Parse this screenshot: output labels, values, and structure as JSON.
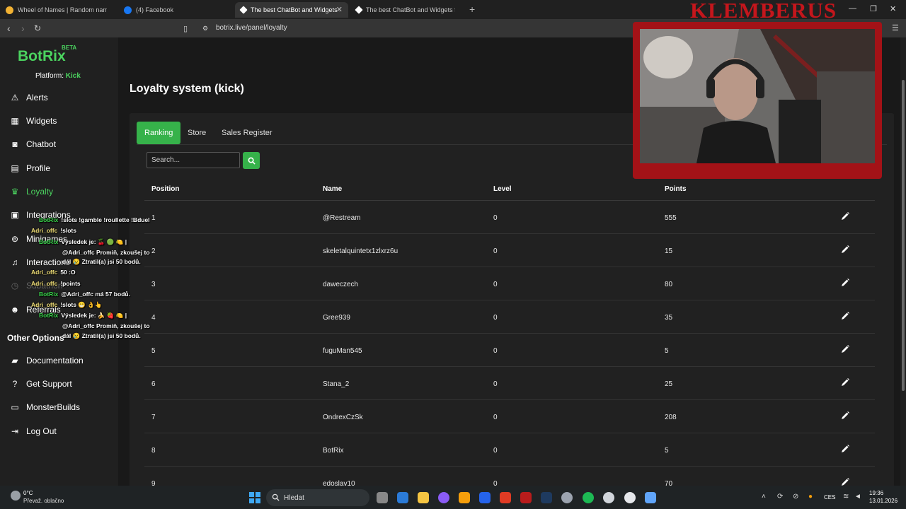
{
  "browser": {
    "tabs": [
      {
        "title": "Wheel of Names | Random name picker",
        "favicon_color": "#f2b233",
        "active": false
      },
      {
        "title": "(4) Facebook",
        "favicon_color": "#1877f2",
        "active": false
      },
      {
        "title": "The best ChatBot and Widgets for Kick",
        "favicon_color": "#ffffff",
        "active": true
      },
      {
        "title": "The best ChatBot and Widgets for Kick",
        "favicon_color": "#ffffff",
        "active": false
      }
    ],
    "url": "botrix.live/panel/loyalty"
  },
  "sidebar": {
    "logo": "BotRix",
    "beta": "BETA",
    "platform_label": "Platform:",
    "platform_value": "Kick",
    "items": [
      {
        "label": "Alerts",
        "icon": "warning-icon"
      },
      {
        "label": "Widgets",
        "icon": "grid-icon"
      },
      {
        "label": "Chatbot",
        "icon": "robot-icon"
      },
      {
        "label": "Profile",
        "icon": "id-card-icon"
      },
      {
        "label": "Loyalty",
        "icon": "trophy-icon",
        "active": true
      },
      {
        "label": "Integrations",
        "icon": "plug-icon"
      },
      {
        "label": "Minigames",
        "icon": "gamepad-icon"
      },
      {
        "label": "Interactions",
        "icon": "music-icon"
      },
      {
        "label": "Subathon",
        "icon": "clock-icon"
      },
      {
        "label": "Referrals",
        "icon": "users-icon"
      }
    ],
    "other_options": "Other Options",
    "other_items": [
      {
        "label": "Documentation",
        "icon": "book-icon"
      },
      {
        "label": "Get Support",
        "icon": "question-icon"
      },
      {
        "label": "MonsterBuilds",
        "icon": "monitor-icon"
      },
      {
        "label": "Log Out",
        "icon": "logout-icon"
      }
    ]
  },
  "main": {
    "title": "Loyalty system (kick)",
    "tabs": [
      {
        "label": "Ranking",
        "active": true
      },
      {
        "label": "Store"
      },
      {
        "label": "Sales Register"
      }
    ],
    "search_placeholder": "Search...",
    "columns": [
      "Position",
      "Name",
      "Level",
      "Points"
    ],
    "rows": [
      {
        "position": "1",
        "name": "@Restream",
        "level": "0",
        "points": "555"
      },
      {
        "position": "2",
        "name": "skeletalquintetx1zlxrz6u",
        "level": "0",
        "points": "15"
      },
      {
        "position": "3",
        "name": "daweczech",
        "level": "0",
        "points": "80"
      },
      {
        "position": "4",
        "name": "Gree939",
        "level": "0",
        "points": "35"
      },
      {
        "position": "5",
        "name": "fuguMan545",
        "level": "0",
        "points": "5"
      },
      {
        "position": "6",
        "name": "Stana_2",
        "level": "0",
        "points": "25"
      },
      {
        "position": "7",
        "name": "OndrexCzSk",
        "level": "0",
        "points": "208"
      },
      {
        "position": "8",
        "name": "BotRix",
        "level": "0",
        "points": "5"
      },
      {
        "position": "9",
        "name": "edoslav10",
        "level": "0",
        "points": "70"
      }
    ]
  },
  "overlay": {
    "streamer_name": "KLEMBERUS",
    "chat": [
      {
        "user": "BotRix",
        "text": "!slots !gamble !roullette !Bduel",
        "bot": true
      },
      {
        "user": "Adri_offc",
        "text": "!slots",
        "bot": false
      },
      {
        "user": "BotRix",
        "text": "Výsledek je: 🍒 🟢 🍋 |",
        "bot": true
      },
      {
        "user": "",
        "text": "@Adri_offc Promiň, zkoušej to",
        "bot": true
      },
      {
        "user": "",
        "text": "dál 😢 Ztratil(a) jsi 50 bodů.",
        "bot": true
      },
      {
        "user": "Adri_offc",
        "text": "50 :O",
        "bot": false
      },
      {
        "user": "Adri_offc",
        "text": "!points",
        "bot": false
      },
      {
        "user": "BotRix",
        "text": "@Adri_offc má 57 bodů.",
        "bot": true
      },
      {
        "user": "Adri_offc",
        "text": "!slots 😁 👌👆",
        "bot": false
      },
      {
        "user": "BotRix",
        "text": "Výsledek je: 🍌 🍓 🍋 |",
        "bot": true
      },
      {
        "user": "",
        "text": "@Adri_offc Promiň, zkoušej to",
        "bot": true
      },
      {
        "user": "",
        "text": "dál 😢 Ztratil(a) jsi 50 bodů.",
        "bot": true
      }
    ]
  },
  "taskbar": {
    "weather_temp": "0°C",
    "weather_desc": "Převaž. oblačno",
    "search_label": "Hledat",
    "lang": "CES",
    "time": "19:36",
    "date": "13.01.2026"
  },
  "colors": {
    "accent": "#36b24a",
    "brand_green": "#4bd35f",
    "overlay_red": "#a31217"
  }
}
